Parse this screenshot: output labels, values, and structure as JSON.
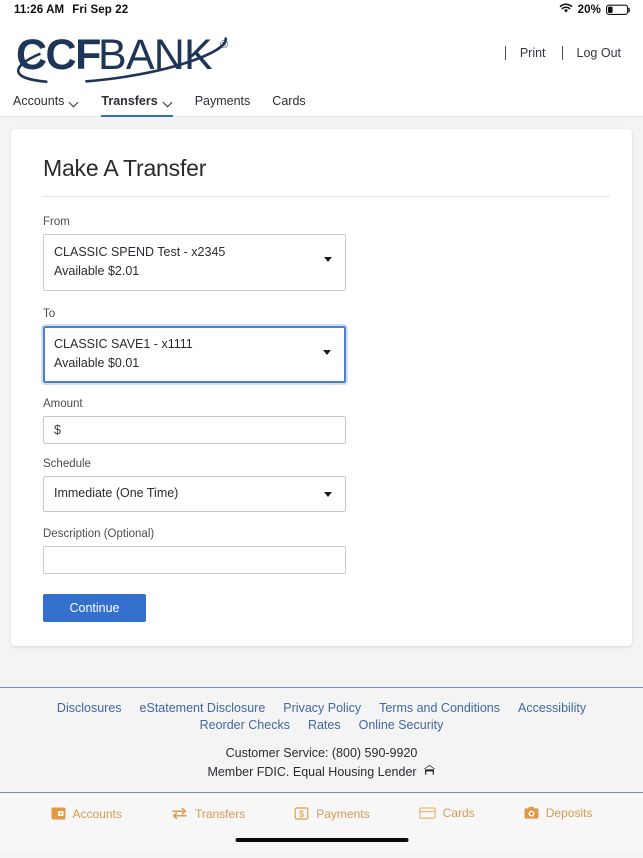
{
  "status_bar": {
    "time": "11:26 AM",
    "date": "Fri Sep 22",
    "battery_pct": "20%",
    "wifi_icon": "wifi-icon",
    "battery_icon": "battery-icon"
  },
  "header": {
    "logo_text_bold": "CCF",
    "logo_text_light": "BANK",
    "logo_trademark": "®",
    "links": [
      {
        "label": "Print"
      },
      {
        "label": "Log Out"
      }
    ]
  },
  "nav": {
    "items": [
      {
        "label": "Accounts",
        "has_caret": true,
        "active": false
      },
      {
        "label": "Transfers",
        "has_caret": true,
        "active": true
      },
      {
        "label": "Payments",
        "has_caret": false,
        "active": false
      },
      {
        "label": "Cards",
        "has_caret": false,
        "active": false
      }
    ]
  },
  "main": {
    "title": "Make A Transfer",
    "from": {
      "label": "From",
      "account": "CLASSIC SPEND Test - x2345",
      "available": "Available  $2.01"
    },
    "to": {
      "label": "To",
      "account": "CLASSIC SAVE1 - x1111",
      "available": "Available  $0.01"
    },
    "amount": {
      "label": "Amount",
      "value": "",
      "placeholder": "$"
    },
    "schedule": {
      "label": "Schedule",
      "value": "Immediate (One Time)"
    },
    "description": {
      "label": "Description (Optional)",
      "value": "",
      "placeholder": ""
    },
    "continue_label": "Continue"
  },
  "footer": {
    "links": [
      {
        "label": "Disclosures"
      },
      {
        "label": "eStatement Disclosure"
      },
      {
        "label": "Privacy Policy"
      },
      {
        "label": "Terms and Conditions"
      },
      {
        "label": "Accessibility"
      },
      {
        "label": "Reorder Checks"
      },
      {
        "label": "Rates"
      },
      {
        "label": "Online Security"
      }
    ],
    "customer_service": "Customer Service: (800) 590-9920",
    "fdic_text": "Member FDIC. Equal Housing Lender",
    "fdic_icon": "equal-housing-lender-icon"
  },
  "tabbar": {
    "items": [
      {
        "label": "Accounts",
        "icon": "accounts-icon"
      },
      {
        "label": "Transfers",
        "icon": "transfers-icon"
      },
      {
        "label": "Payments",
        "icon": "payments-icon"
      },
      {
        "label": "Cards",
        "icon": "cards-icon"
      },
      {
        "label": "Deposits",
        "icon": "deposits-icon"
      }
    ]
  },
  "colors": {
    "brand_navy": "#1d3557",
    "accent_blue": "#3470ce",
    "link_blue": "#40699f",
    "tab_orange": "#d79a4e",
    "page_bg": "#f4f4f5"
  }
}
